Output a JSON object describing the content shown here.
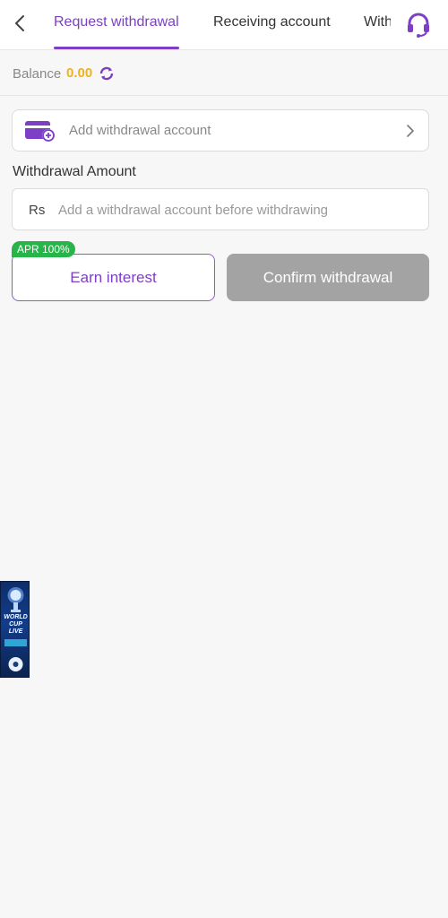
{
  "header": {
    "tabs": [
      {
        "label": "Request withdrawal",
        "active": true
      },
      {
        "label": "Receiving account",
        "active": false
      },
      {
        "label": "With",
        "active": false
      }
    ],
    "accent_color": "#7c3fc6"
  },
  "balance": {
    "label": "Balance",
    "value": "0.00"
  },
  "account": {
    "label": "Add withdrawal account"
  },
  "amount": {
    "title": "Withdrawal Amount",
    "currency": "Rs",
    "placeholder": "Add a withdrawal account before withdrawing"
  },
  "actions": {
    "apr_badge": "APR 100%",
    "earn_label": "Earn interest",
    "confirm_label": "Confirm withdrawal"
  },
  "promo": {
    "line1": "WORLD",
    "line2": "CUP",
    "line3": "LIVE"
  }
}
